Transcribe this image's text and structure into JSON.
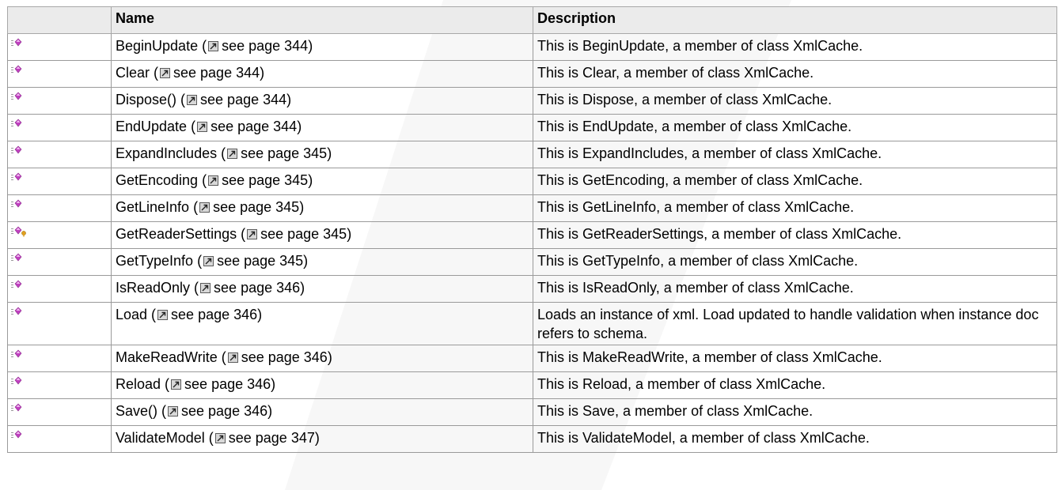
{
  "table": {
    "headers": {
      "icon": "",
      "name": "Name",
      "description": "Description"
    },
    "rows": [
      {
        "name": "BeginUpdate",
        "ref": "see page 344",
        "description": "This is BeginUpdate, a member of class XmlCache.",
        "protected": false
      },
      {
        "name": "Clear",
        "ref": "see page 344",
        "description": "This is Clear, a member of class XmlCache.",
        "protected": false
      },
      {
        "name": "Dispose()",
        "ref": "see page 344",
        "description": "This is Dispose, a member of class XmlCache.",
        "protected": false
      },
      {
        "name": "EndUpdate",
        "ref": "see page 344",
        "description": "This is EndUpdate, a member of class XmlCache.",
        "protected": false
      },
      {
        "name": "ExpandIncludes",
        "ref": "see page 345",
        "description": "This is ExpandIncludes, a member of class XmlCache.",
        "protected": false
      },
      {
        "name": "GetEncoding",
        "ref": "see page 345",
        "description": "This is GetEncoding, a member of class XmlCache.",
        "protected": false
      },
      {
        "name": "GetLineInfo",
        "ref": "see page 345",
        "description": "This is GetLineInfo, a member of class XmlCache.",
        "protected": false
      },
      {
        "name": "GetReaderSettings",
        "ref": "see page 345",
        "description": "This is GetReaderSettings, a member of class XmlCache.",
        "protected": true
      },
      {
        "name": "GetTypeInfo",
        "ref": "see page 345",
        "description": "This is GetTypeInfo, a member of class XmlCache.",
        "protected": false
      },
      {
        "name": "IsReadOnly",
        "ref": "see page 346",
        "description": "This is IsReadOnly, a member of class XmlCache.",
        "protected": false
      },
      {
        "name": "Load",
        "ref": "see page 346",
        "description": "Loads an instance of xml. Load updated to handle validation when instance doc refers to schema.",
        "protected": false
      },
      {
        "name": "MakeReadWrite",
        "ref": "see page 346",
        "description": "This is MakeReadWrite, a member of class XmlCache.",
        "protected": false
      },
      {
        "name": "Reload",
        "ref": "see page 346",
        "description": "This is Reload, a member of class XmlCache.",
        "protected": false
      },
      {
        "name": "Save()",
        "ref": "see page 346",
        "description": "This is Save, a member of class XmlCache.",
        "protected": false
      },
      {
        "name": "ValidateModel",
        "ref": "see page 347",
        "description": "This is ValidateModel, a member of class XmlCache.",
        "protected": false
      }
    ]
  },
  "icons": {
    "public_method": "public-method-icon",
    "protected_method": "protected-method-icon",
    "page_reference": "page-reference-icon",
    "method_color": "#c040c0",
    "key_color": "#e0a020"
  }
}
